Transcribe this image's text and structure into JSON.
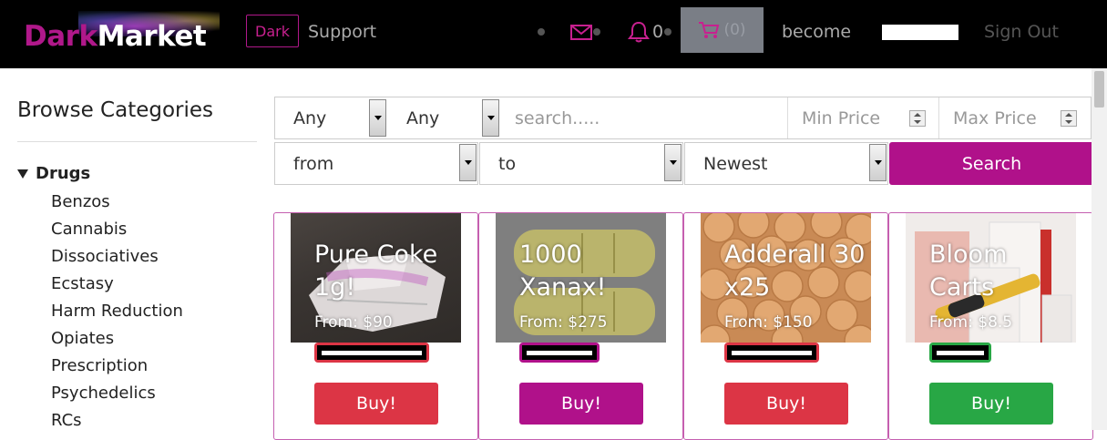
{
  "navbar": {
    "logo": {
      "dark": "Dark",
      "market": "Market"
    },
    "theme_button": "Dark",
    "support": "Support",
    "notifications_count": "0",
    "cart_count": "(0)",
    "become": "become",
    "sign_out": "Sign Out"
  },
  "colors": {
    "brand": "#b0188a",
    "danger": "#dc3545",
    "success": "#28a745",
    "navbar_bg": "#000000"
  },
  "sidebar": {
    "title": "Browse Categories",
    "category": "Drugs",
    "subcategories": [
      "Benzos",
      "Cannabis",
      "Dissociatives",
      "Ecstasy",
      "Harm Reduction",
      "Opiates",
      "Prescription",
      "Psychedelics",
      "RCs"
    ]
  },
  "filters": {
    "select1": "Any",
    "select2": "Any",
    "search_placeholder": "search.....",
    "min_price_placeholder": "Min Price",
    "max_price_placeholder": "Max Price",
    "from": "from",
    "to": "to",
    "sort": "Newest",
    "search_button": "Search"
  },
  "products": [
    {
      "title": "Pure Coke 1g!",
      "price": "From: $90",
      "buy": "Buy!",
      "badge_color": "#dc3545",
      "button_color": "#dc3545"
    },
    {
      "title": "1000 Xanax!",
      "price": "From: $275",
      "buy": "Buy!",
      "badge_color": "#b0118a",
      "button_color": "#b0118a"
    },
    {
      "title": "Adderall 30 x25",
      "price": "From: $150",
      "buy": "Buy!",
      "badge_color": "#dc3545",
      "button_color": "#dc3545"
    },
    {
      "title": "Bloom Carts",
      "price": "From: $8.5",
      "buy": "Buy!",
      "badge_color": "#28a745",
      "button_color": "#28a745"
    }
  ]
}
